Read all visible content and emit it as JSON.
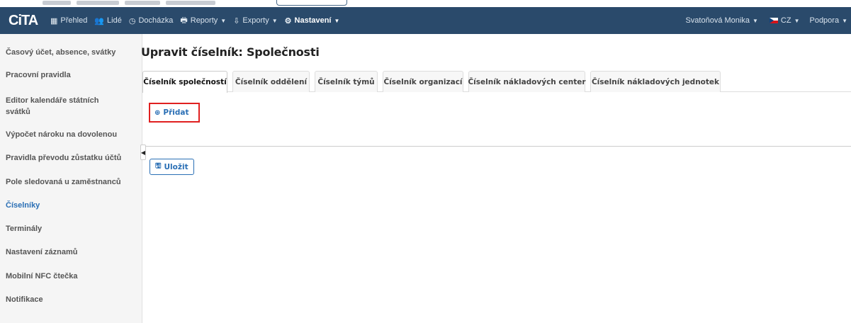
{
  "navbar": {
    "logo": "CiTA",
    "items": [
      {
        "label": "Přehled",
        "icon": "▦",
        "caret": false
      },
      {
        "label": "Lidé",
        "icon": "👥",
        "caret": false
      },
      {
        "label": "Docházka",
        "icon": "◷",
        "caret": false
      },
      {
        "label": "Reporty",
        "icon": "🖶",
        "caret": true
      },
      {
        "label": "Exporty",
        "icon": "⇩",
        "caret": true
      },
      {
        "label": "Nastavení",
        "icon": "⚙",
        "caret": true
      }
    ],
    "user": "Svatoňová Monika",
    "language": "CZ",
    "support": "Podpora"
  },
  "sidebar": {
    "items": [
      {
        "label": "Časový účet, absence, svátky"
      },
      {
        "label": "Pracovní pravidla"
      },
      {
        "label": "Editor kalendáře státních svátků"
      },
      {
        "label": "Výpočet nároku na dovolenou"
      },
      {
        "label": "Pravidla převodu zůstatku účtů"
      },
      {
        "label": "Pole sledovaná u zaměstnanců"
      },
      {
        "label": "Číselníky"
      },
      {
        "label": "Terminály"
      },
      {
        "label": "Nastavení záznamů"
      },
      {
        "label": "Mobilní NFC čtečka"
      },
      {
        "label": "Notifikace"
      }
    ],
    "active_index": 6
  },
  "main": {
    "title": "Upravit číselník: Společnosti",
    "tabs": [
      {
        "label": "Číselník společností"
      },
      {
        "label": "Číselník oddělení"
      },
      {
        "label": "Číselník týmů"
      },
      {
        "label": "Číselník organizací"
      },
      {
        "label": "Číselník nákladových center"
      },
      {
        "label": "Číselník nákladových jednotek"
      }
    ],
    "add_button": "Přidat",
    "save_button": "Uložit"
  },
  "colors": {
    "navbar_bg": "#2a4a6b",
    "accent": "#2a6fb5",
    "highlight": "#e02020"
  }
}
